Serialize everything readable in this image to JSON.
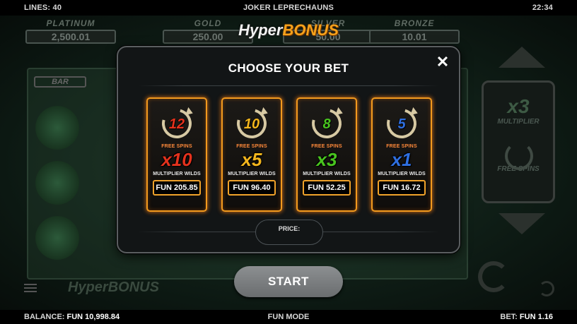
{
  "topbar": {
    "lines": "LINES: 40",
    "title": "JOKER LEPRECHAUNS",
    "clock": "22:34"
  },
  "jackpots": [
    {
      "label": "PLATINUM",
      "value": "2,500.01"
    },
    {
      "label": "GOLD",
      "value": "250.00"
    },
    {
      "label": "SILVER",
      "value": "50.00"
    },
    {
      "label": "BRONZE",
      "value": "10.01"
    }
  ],
  "background": {
    "bar_tag": "BAR",
    "side_multiplier": "x3",
    "side_multiplier_label": "MULTIPLIER",
    "side_free_spins_label": "FREE SPINS",
    "bottom_logo": "HyperBONUS"
  },
  "logo": {
    "hyper": "Hyper",
    "bonus": "BONUS"
  },
  "modal": {
    "title": "CHOOSE YOUR BET",
    "close": "✕",
    "price_label": "PRICE:",
    "cards": [
      {
        "spins": "12",
        "free_spins_label": "FREE SPINS",
        "multiplier": "x10",
        "multiplier_label": "MULTIPLIER WILDS",
        "price": "FUN 205.85",
        "color": "#e4321d"
      },
      {
        "spins": "10",
        "free_spins_label": "FREE SPINS",
        "multiplier": "x5",
        "multiplier_label": "MULTIPLIER WILDS",
        "price": "FUN 96.40",
        "color": "#f2b51d"
      },
      {
        "spins": "8",
        "free_spins_label": "FREE SPINS",
        "multiplier": "x3",
        "multiplier_label": "MULTIPLIER WILDS",
        "price": "FUN 52.25",
        "color": "#49c41f"
      },
      {
        "spins": "5",
        "free_spins_label": "FREE SPINS",
        "multiplier": "x1",
        "multiplier_label": "MULTIPLIER WILDS",
        "price": "FUN 16.72",
        "color": "#2f6fe0"
      }
    ]
  },
  "start_label": "START",
  "bottombar": {
    "balance_label": "BALANCE:",
    "balance_value": "FUN 10,998.84",
    "mode": "FUN MODE",
    "bet_label": "BET:",
    "bet_value": "FUN 1.16"
  }
}
